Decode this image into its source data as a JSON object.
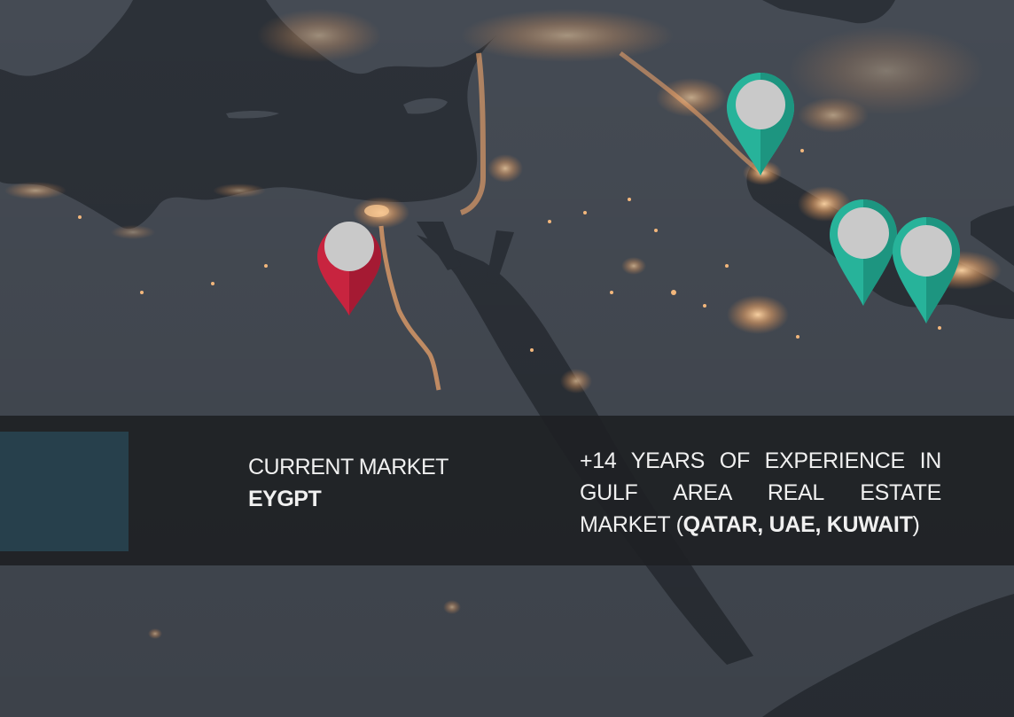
{
  "market": {
    "label": "CURRENT MARKET",
    "value": "EYGPT"
  },
  "experience": {
    "text_start": "+14 YEARS OF EXPERIENCE IN GULF AREA REAL ESTATE MARKET (",
    "highlight": "QATAR, UAE, KUWAIT",
    "text_end": ")"
  },
  "pins": [
    {
      "name": "pin-egypt",
      "color": "#c8243f",
      "color_dark": "#a51a33"
    },
    {
      "name": "pin-kuwait",
      "color": "#27b39a",
      "color_dark": "#1d9580"
    },
    {
      "name": "pin-qatar",
      "color": "#27b39a",
      "color_dark": "#1d9580"
    },
    {
      "name": "pin-uae",
      "color": "#27b39a",
      "color_dark": "#1d9580"
    }
  ],
  "colors": {
    "sea": "#2c3138",
    "land": "#454b54",
    "lights": "#f3b77c",
    "band": "#1e2023",
    "swatch": "#27404c",
    "pin_head": "#c9c9c9"
  }
}
